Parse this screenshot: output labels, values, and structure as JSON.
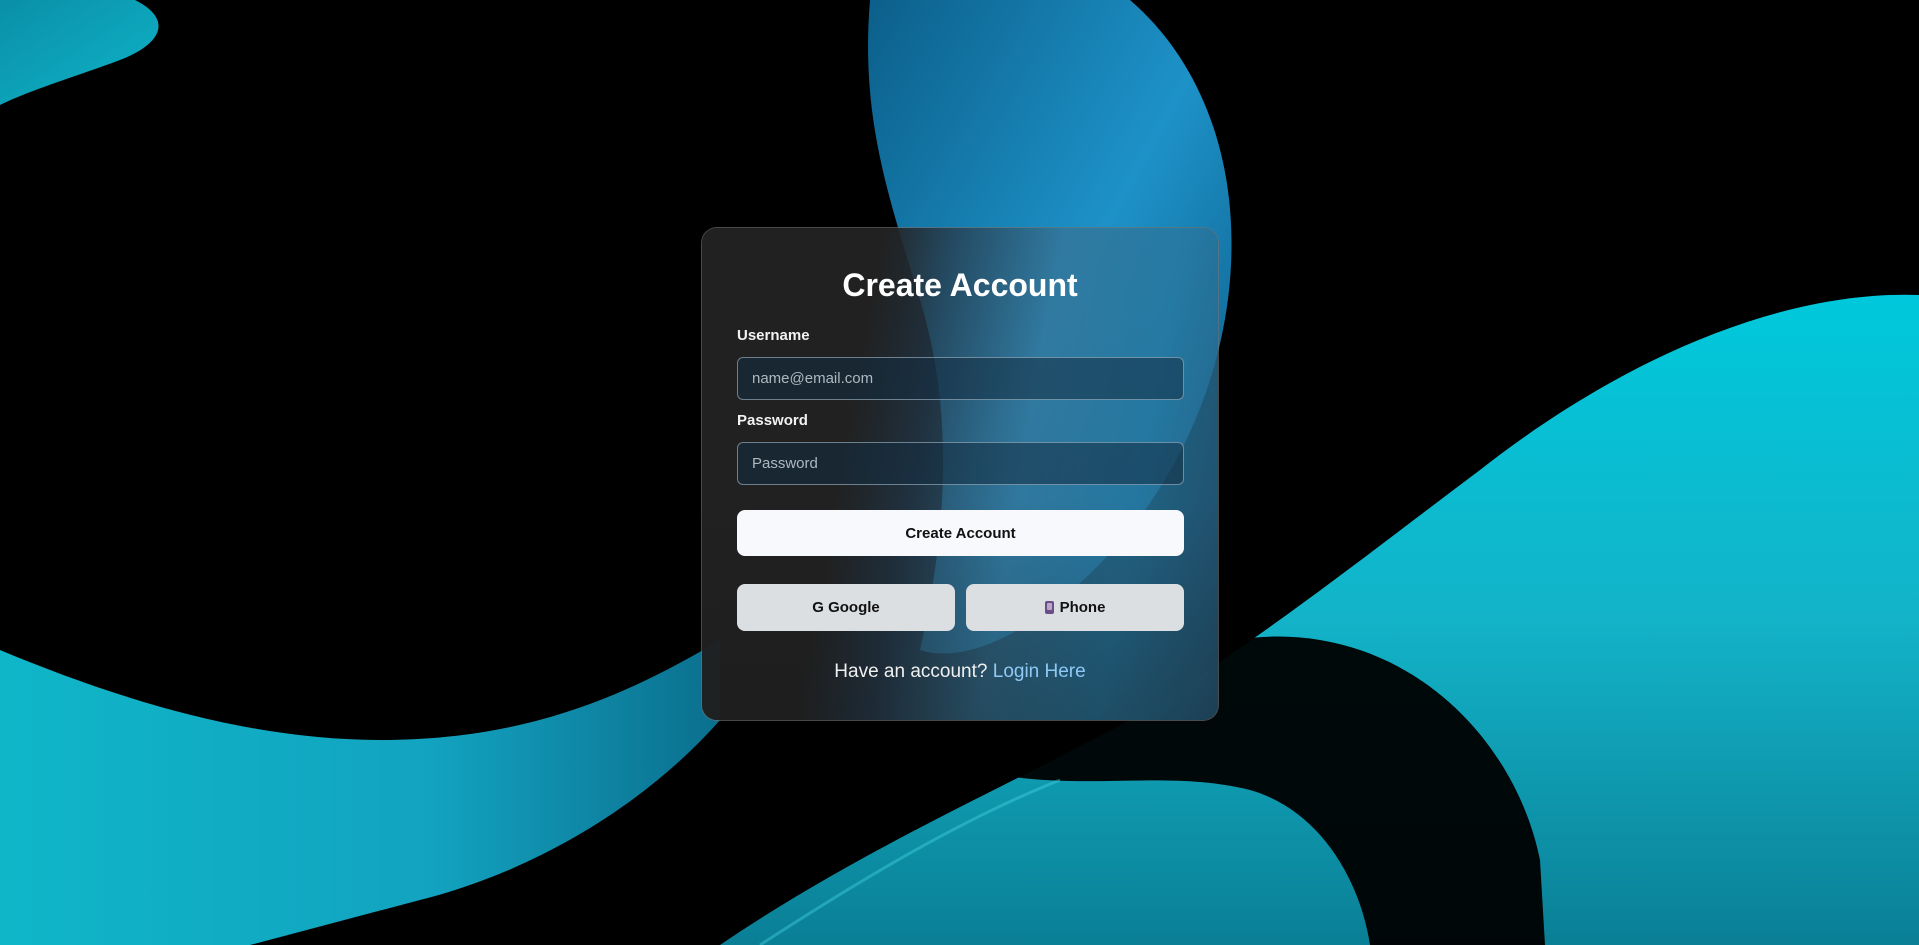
{
  "form": {
    "title": "Create Account",
    "username_label": "Username",
    "username_placeholder": "name@email.com",
    "password_label": "Password",
    "password_placeholder": "Password",
    "submit_label": "Create Account",
    "google_label": "G Google",
    "phone_label": "Phone",
    "phone_icon": "mobile-phone-icon",
    "footer_text": "Have an account?",
    "login_link_label": "Login Here"
  },
  "colors": {
    "background": "#000000",
    "accent_cyan": "#00c6d8",
    "accent_blue": "#1e8fc6",
    "link": "#8ec9f5"
  }
}
